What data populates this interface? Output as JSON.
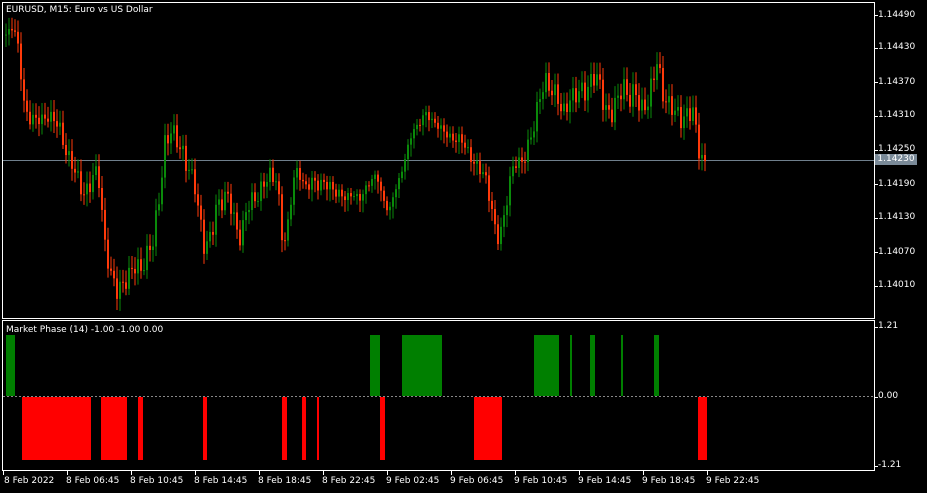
{
  "main_header": "EURUSD, M15:  Euro vs US Dollar",
  "indicator_header": "Market Phase (14) -1.00 -1.00 0.00",
  "price_axis": [
    "1.14490",
    "1.14430",
    "1.14370",
    "1.14310",
    "1.14250",
    "1.14190",
    "1.14130",
    "1.14070",
    "1.14010"
  ],
  "current_price": "1.14230",
  "indicator_axis": {
    "top": "1.21",
    "zero": "0.00",
    "bottom": "-1.21"
  },
  "time_axis": [
    "8 Feb 2022",
    "8 Feb 06:45",
    "8 Feb 10:45",
    "8 Feb 14:45",
    "8 Feb 18:45",
    "8 Feb 22:45",
    "9 Feb 02:45",
    "9 Feb 06:45",
    "9 Feb 10:45",
    "9 Feb 14:45",
    "9 Feb 18:45",
    "9 Feb 22:45"
  ],
  "colors": {
    "bull": "#0a8a0a",
    "bear": "#ff3a0a",
    "phase_up": "#007f00",
    "phase_down": "#ff0000",
    "grid": "#ffffff",
    "current_line": "#6f7f8c"
  }
}
